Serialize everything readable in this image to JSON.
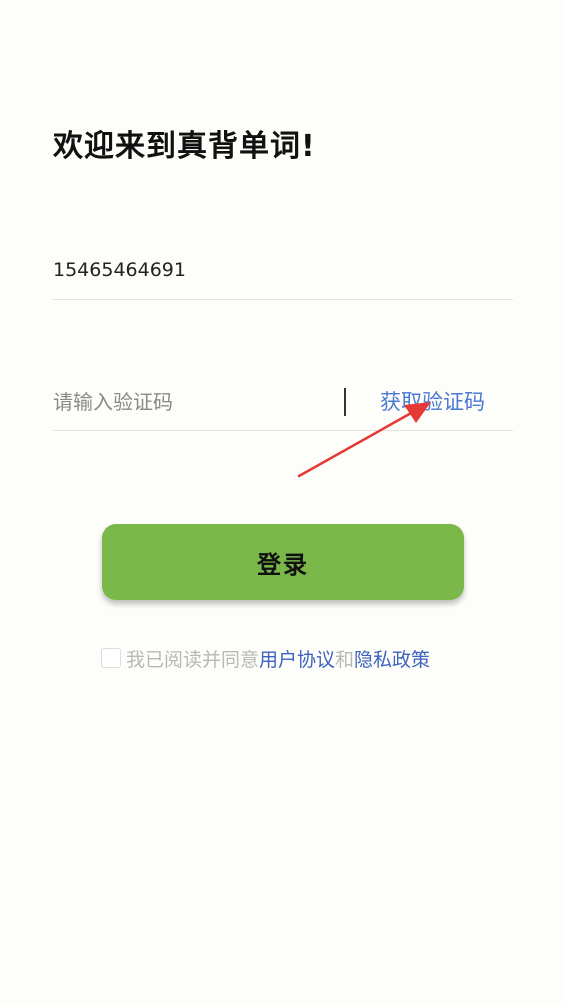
{
  "login": {
    "welcome_title": "欢迎来到真背单词!",
    "phone": {
      "value": "15465464691"
    },
    "verification": {
      "placeholder": "请输入验证码",
      "get_code_label": "获取验证码"
    },
    "login_button_label": "登录",
    "agreement": {
      "prefix": "我已阅读并同意",
      "user_agreement_label": "用户协议",
      "conjunction": "和",
      "privacy_policy_label": "隐私政策",
      "checked": false
    }
  },
  "colors": {
    "background": "#fdfdf9",
    "primary_button": "#7ab84a",
    "link": "#4a79d6",
    "annotation_arrow": "#e53935"
  }
}
